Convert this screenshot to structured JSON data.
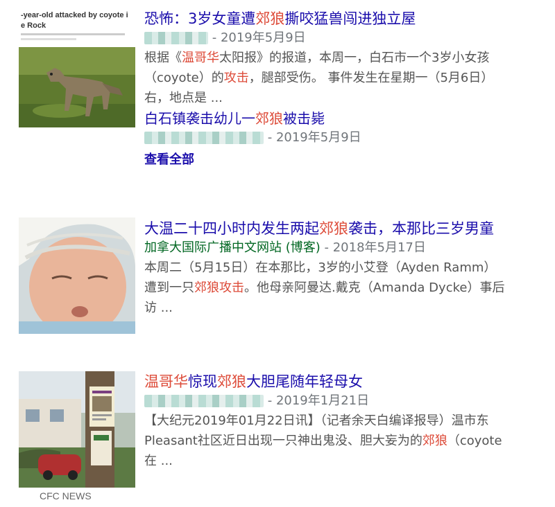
{
  "results": [
    {
      "thumb_text": "-year-old attacked by coyote i\ne Rock",
      "title": {
        "pre": "恐怖：3岁女童遭",
        "hl": "郊狼",
        "post": "撕咬猛兽闯进独立屋"
      },
      "date": "- 2019年5月9日",
      "snippet": [
        {
          "pre": "根据《",
          "hl": "温哥华",
          "post": "太阳报》的报道，本周一，白石市一个3岁小女孩"
        },
        {
          "pre": "（coyote）的",
          "hl": "攻击",
          "post": "，腿部受伤。 事件发生在星期一（5月6日）"
        },
        {
          "pre": "右，地点是 ...",
          "hl": "",
          "post": ""
        }
      ],
      "sub_link": {
        "pre": "白石镇袭击幼儿一",
        "hl": "郊狼",
        "post": "被击毙"
      },
      "sub_date": "- 2019年5月9日",
      "see_all": "查看全部"
    },
    {
      "title": {
        "pre": "大温二十四小时内发生两起",
        "hl": "郊狼",
        "post": "袭击，本那比三岁男童"
      },
      "source": "加拿大国际广播中文网站 (博客)",
      "date": "- 2018年5月17日",
      "snippet": [
        {
          "pre": "本周二（5月15日）在本那比，3岁的小艾登（Ayden Ramm）",
          "hl": "",
          "post": ""
        },
        {
          "pre": "遭到一只",
          "hl": "郊狼攻击",
          "post": "。他母亲阿曼达.戴克（Amanda Dycke）事后"
        },
        {
          "pre": "访 ...",
          "hl": "",
          "post": ""
        }
      ]
    },
    {
      "title": {
        "hl1": "温哥华",
        "mid": "惊现",
        "hl2": "郊狼",
        "post": "大胆尾随年轻母女"
      },
      "date": "- 2019年1月21日",
      "snippet": [
        {
          "pre": "【大纪元2019年01月22日讯】（记者余天白编译报导）温市东",
          "hl": "",
          "post": ""
        },
        {
          "pre": "Pleasant社区近日出现一只神出鬼没、胆大妄为的",
          "hl": "郊狼",
          "post": "（coyote"
        },
        {
          "pre": "在 ...",
          "hl": "",
          "post": ""
        }
      ],
      "thumb_caption": "CFC NEWS"
    }
  ],
  "colors": {
    "link": "#1a0dab",
    "highlight": "#dd4b39",
    "snippet": "#545454",
    "meta": "#70757a",
    "source": "#006621"
  }
}
